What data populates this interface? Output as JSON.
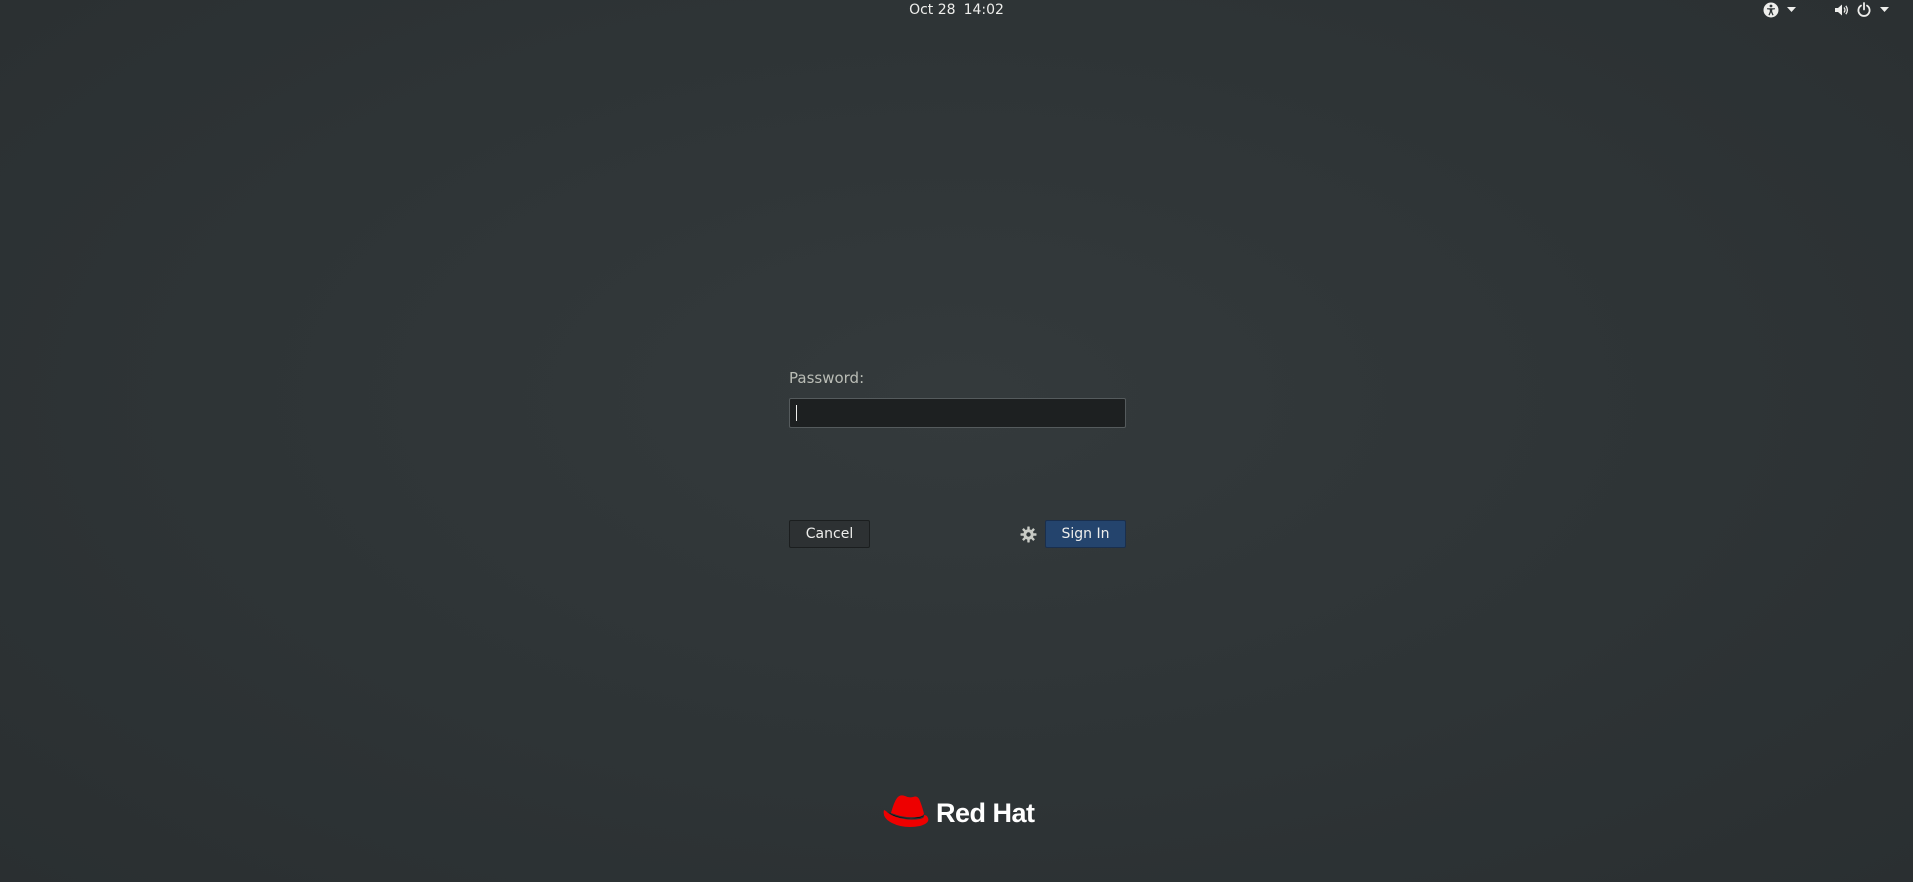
{
  "topbar": {
    "date": "Oct 28",
    "time": "14:02",
    "icons": [
      "accessibility-icon",
      "dropdown-arrow-icon",
      "volume-icon",
      "power-icon",
      "dropdown-arrow-icon"
    ]
  },
  "login": {
    "password_label": "Password:",
    "password_value": "",
    "cancel_label": "Cancel",
    "signin_label": "Sign In",
    "session_icon": "gear-icon"
  },
  "branding": {
    "logo_text": "Red Hat",
    "logo_color": "#ee0000"
  },
  "colors": {
    "background": "#2e3436",
    "signin_button": "#24446d"
  }
}
